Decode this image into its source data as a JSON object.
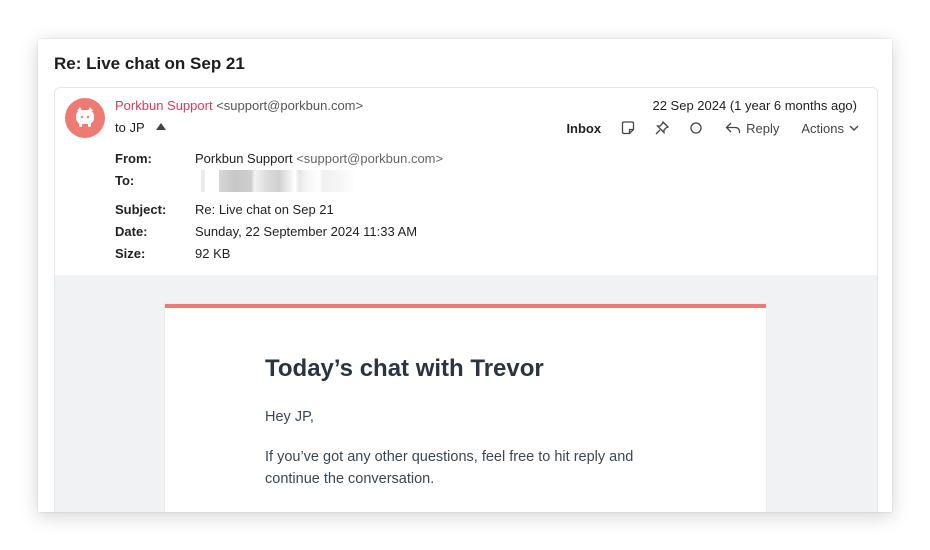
{
  "thread": {
    "title": "Re: Live chat on Sep 21"
  },
  "message": {
    "sender_name": "Porkbun Support",
    "sender_email": "<support@porkbun.com>",
    "to_summary": "to JP",
    "date_summary": "22 Sep 2024 (1 year 6 months ago)",
    "avatar_color": "#ef7a73",
    "toolbar": {
      "folder": "Inbox",
      "note_icon": "note-icon",
      "pin_icon": "pin-icon",
      "mark_icon": "circle-icon",
      "reply_label": "Reply",
      "actions_label": "Actions"
    },
    "headers": {
      "from_label": "From:",
      "from_name": "Porkbun Support",
      "from_email": "<support@porkbun.com>",
      "to_label": "To:",
      "subject_label": "Subject:",
      "subject_value": "Re: Live chat on Sep 21",
      "date_label": "Date:",
      "date_value": "Sunday, 22 September 2024 11:33 AM",
      "size_label": "Size:",
      "size_value": "92 KB"
    },
    "body": {
      "accent_color": "#ef7a73",
      "heading": "Today’s chat with Trevor",
      "greeting": "Hey JP,",
      "paragraph": "If you’ve got any other questions, feel free to hit reply and continue the conversation."
    }
  }
}
